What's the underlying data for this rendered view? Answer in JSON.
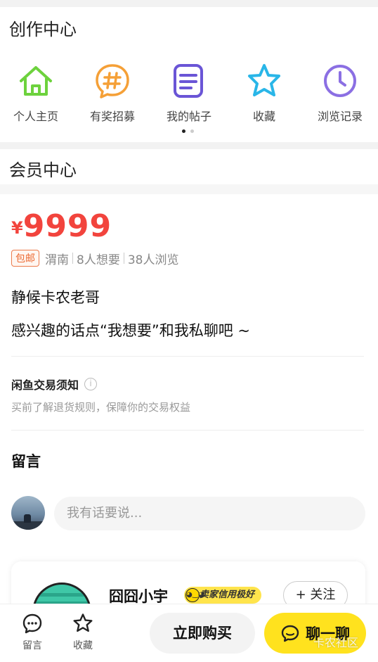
{
  "creation": {
    "title": "创作中心",
    "tools": [
      {
        "label": "个人主页",
        "icon": "home-icon",
        "color": "#6dd23d"
      },
      {
        "label": "有奖招募",
        "icon": "hashtag-icon",
        "color": "#f5a037"
      },
      {
        "label": "我的帖子",
        "icon": "post-icon",
        "color": "#6a55d6"
      },
      {
        "label": "收藏",
        "icon": "star-icon",
        "color": "#29b6e8"
      },
      {
        "label": "浏览记录",
        "icon": "clock-icon",
        "color": "#8b6fe3"
      }
    ],
    "page_indicator": {
      "pages": 2,
      "active": 0
    }
  },
  "member": {
    "title": "会员中心"
  },
  "listing": {
    "currency": "¥",
    "price": "9999",
    "shipping_badge": "包邮",
    "location": "渭南",
    "wants": "8人想要",
    "views": "38人浏览",
    "desc_line1": "静候卡农老哥",
    "desc_line2": "感兴趣的话点“我想要”和我私聊吧 ~"
  },
  "notice": {
    "title": "闲鱼交易须知",
    "info_icon": "i",
    "subtitle": "买前了解退货规则，保障你的交易权益"
  },
  "comments": {
    "title": "留言",
    "input_placeholder": "我有话要说..."
  },
  "seller": {
    "name": "囧囧小宇",
    "credit_badge": "卖家信用极好",
    "follow_label": "+ 关注"
  },
  "bottom_bar": {
    "comment_label": "留言",
    "fav_label": "收藏",
    "buy_label": "立即购买",
    "chat_label": "聊一聊"
  },
  "watermark": "卡农社区",
  "colors": {
    "price": "#f2443d",
    "chat_button": "#ffe21e",
    "credit_badge": "#ffe44c"
  }
}
